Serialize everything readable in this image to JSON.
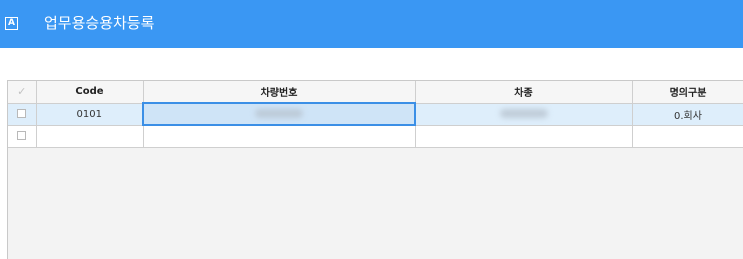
{
  "window": {
    "title": "업무용승용차등록",
    "icon_letter": "A",
    "icon": "app-letter-icon"
  },
  "colors": {
    "titlebar": "#3a97f3",
    "selection": "#deeefb",
    "active_border": "#3b8fe6"
  },
  "grid": {
    "header_check_glyph": "✓",
    "columns": [
      "Code",
      "차량번호",
      "차종",
      "명의구분"
    ],
    "rows": [
      {
        "code": "0101",
        "plate": "",
        "model": "",
        "ownership": "0.회사",
        "selected": true
      },
      {
        "code": "",
        "plate": "",
        "model": "",
        "ownership": "",
        "selected": false
      }
    ]
  }
}
